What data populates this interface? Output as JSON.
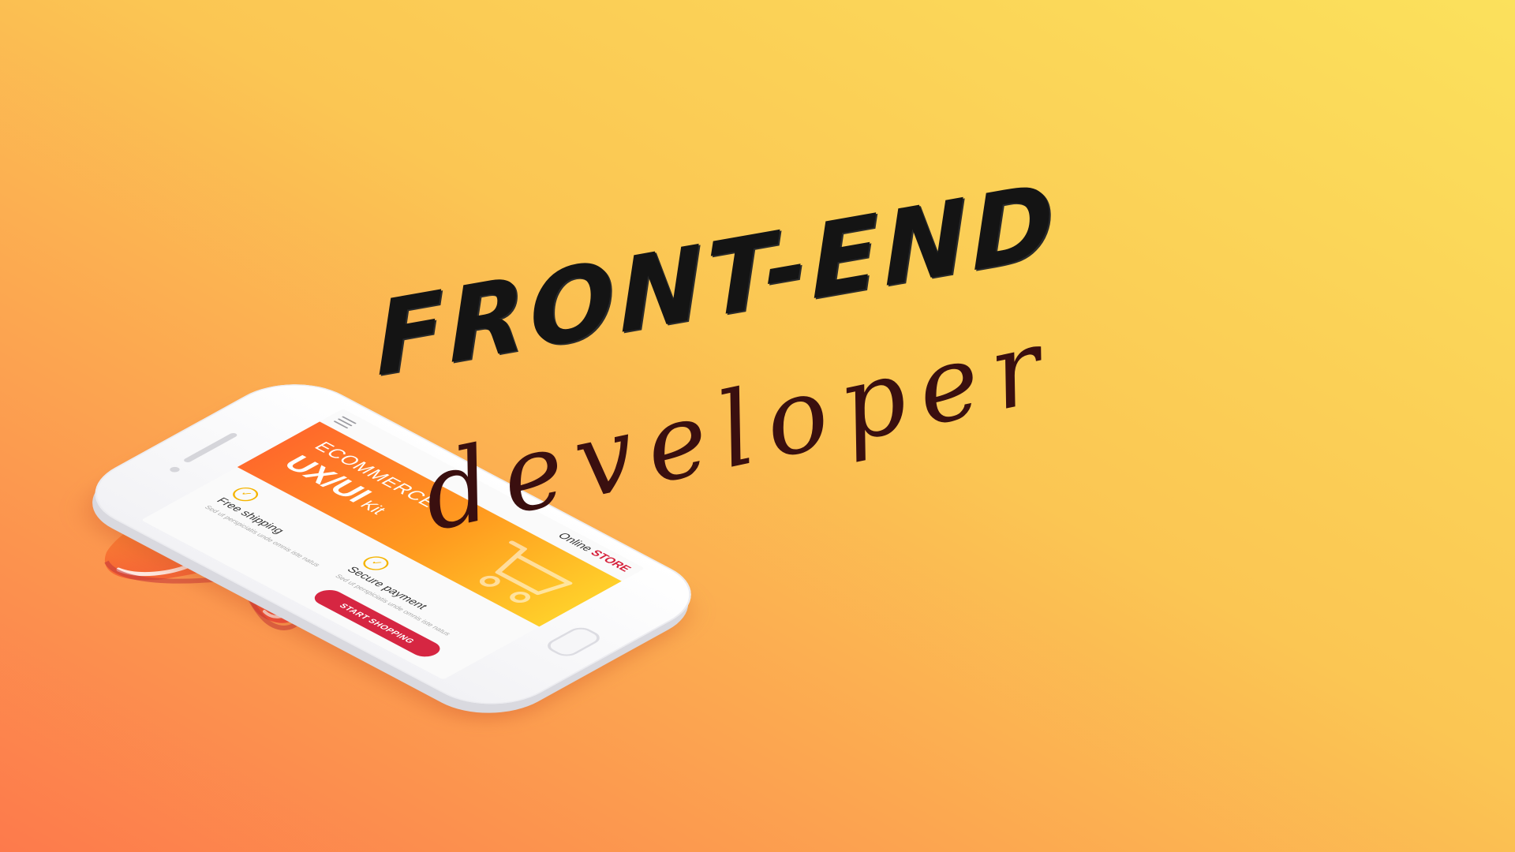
{
  "headline": {
    "title": "FRONT-END",
    "subtitle": "developer"
  },
  "phone": {
    "store_prefix": "Online",
    "store_name": "STORE",
    "hero_line1": "ECOMMERCE",
    "hero_line2": "UX/UI",
    "hero_kit": "Kit",
    "features": [
      {
        "title": "Free shipping",
        "description": "Sed ut perspiciatis unde omnis iste natus"
      },
      {
        "title": "Secure payment",
        "description": "Sed ut perspiciatis unde omnis iste natus"
      }
    ],
    "cta_label": "START SHOPPING"
  },
  "colors": {
    "background_top_right": "#fbda5b",
    "background_bottom_left": "#fd7e4e",
    "accent_red": "#d62642",
    "headline_color": "#141414",
    "subtitle_color": "#3a0f0f"
  },
  "icons": [
    "menu-icon",
    "cart-icon",
    "check-icon"
  ]
}
